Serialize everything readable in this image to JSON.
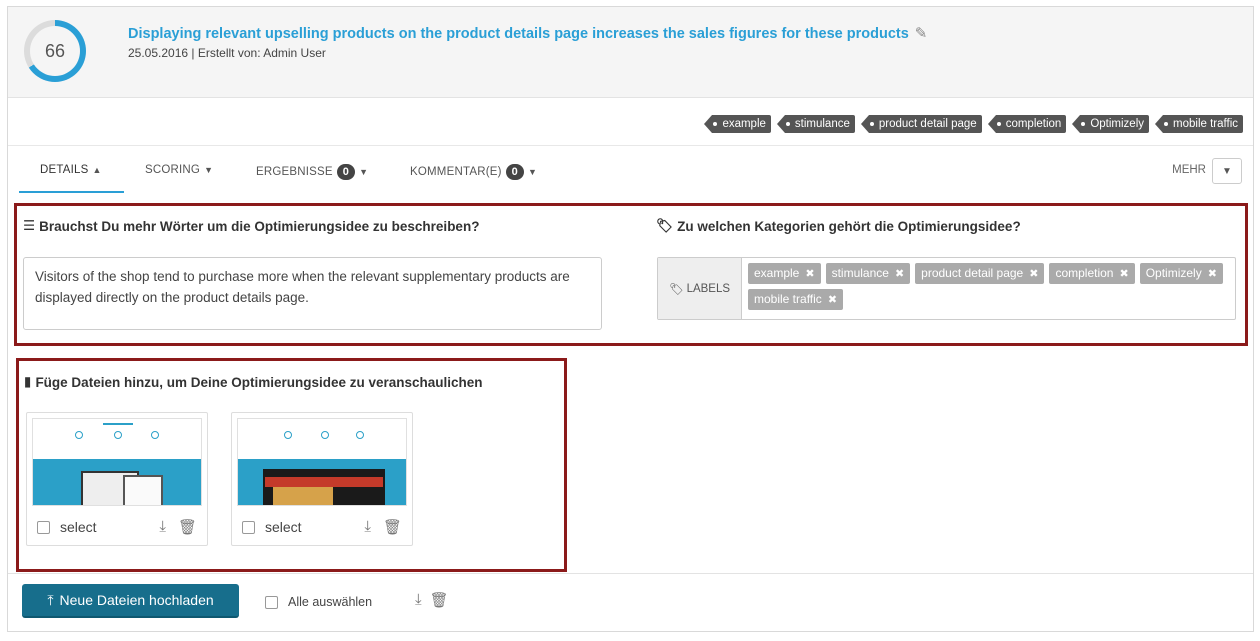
{
  "header": {
    "score": "66",
    "score_fraction": 0.66,
    "title": "Displaying relevant upselling products on the product details page increases the sales figures for these products",
    "meta": "25.05.2016 | Erstellt von: Admin User",
    "icons": {
      "edit": "pencil-icon"
    }
  },
  "tags": [
    "example",
    "stimulance",
    "product detail page",
    "completion",
    "Optimizely",
    "mobile traffic"
  ],
  "tabs": [
    {
      "label": "DETAILS",
      "badge": null,
      "active": true
    },
    {
      "label": "SCORING",
      "badge": null,
      "active": false
    },
    {
      "label": "ERGEBNISSE",
      "badge": "0",
      "active": false
    },
    {
      "label": "KOMMENTAR(E)",
      "badge": "0",
      "active": false
    }
  ],
  "more_label": "MEHR",
  "description": {
    "heading": "Brauchst Du mehr Wörter um die Optimierungsidee zu beschreiben?",
    "text": "Visitors of the shop tend to purchase more when the relevant supplementary products are displayed directly on the product details page."
  },
  "categories": {
    "heading": "Zu welchen Kategorien gehört die Optimierungsidee?",
    "addon_label": "LABELS",
    "chips": [
      "example",
      "stimulance",
      "product detail page",
      "completion",
      "Optimizely",
      "mobile traffic"
    ]
  },
  "files": {
    "heading": "Füge Dateien hinzu, um Deine Optimierungsidee zu veranschaulichen",
    "items": [
      {
        "select_label": "select"
      },
      {
        "select_label": "select"
      }
    ]
  },
  "footer": {
    "upload_label": "Neue Dateien hochladen",
    "select_all_label": "Alle auswählen"
  },
  "colors": {
    "accent": "#2a9fd6",
    "highlight": "#8b1a1a",
    "upload": "#176e8c",
    "tag": "#555555",
    "chip": "#aaaaaa"
  }
}
